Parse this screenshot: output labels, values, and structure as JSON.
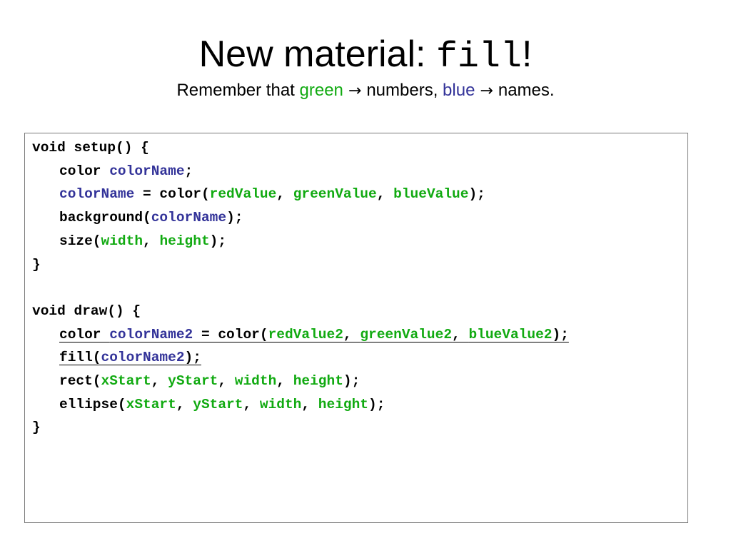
{
  "slide": {
    "title_main": "New material: ",
    "title_code": "fill",
    "title_end": "!",
    "subtitle": {
      "part1": "Remember that ",
      "green_word": "green",
      "arrow1": " → ",
      "part2": "numbers, ",
      "blue_word": "blue",
      "arrow2": " → ",
      "part3": "names."
    }
  },
  "colors": {
    "green_numbers": "#11aa11",
    "blue_names": "#333399"
  },
  "code": {
    "lines": [
      {
        "indent": false,
        "underline": false,
        "tokens": [
          {
            "text": "void setup() {",
            "type": "plain"
          }
        ]
      },
      {
        "indent": true,
        "underline": false,
        "tokens": [
          {
            "text": "color ",
            "type": "plain"
          },
          {
            "text": "colorName",
            "type": "name"
          },
          {
            "text": ";",
            "type": "plain"
          }
        ]
      },
      {
        "indent": true,
        "underline": false,
        "tokens": [
          {
            "text": "colorName",
            "type": "name"
          },
          {
            "text": " = color(",
            "type": "plain"
          },
          {
            "text": "redValue",
            "type": "num"
          },
          {
            "text": ", ",
            "type": "plain"
          },
          {
            "text": "greenValue",
            "type": "num"
          },
          {
            "text": ", ",
            "type": "plain"
          },
          {
            "text": "blueValue",
            "type": "num"
          },
          {
            "text": ");",
            "type": "plain"
          }
        ]
      },
      {
        "indent": true,
        "underline": false,
        "tokens": [
          {
            "text": "background(",
            "type": "plain"
          },
          {
            "text": "colorName",
            "type": "name"
          },
          {
            "text": ");",
            "type": "plain"
          }
        ]
      },
      {
        "indent": true,
        "underline": false,
        "tokens": [
          {
            "text": "size(",
            "type": "plain"
          },
          {
            "text": "width",
            "type": "num"
          },
          {
            "text": ", ",
            "type": "plain"
          },
          {
            "text": "height",
            "type": "num"
          },
          {
            "text": ");",
            "type": "plain"
          }
        ]
      },
      {
        "indent": false,
        "underline": false,
        "tokens": [
          {
            "text": "}",
            "type": "plain"
          }
        ]
      },
      {
        "indent": false,
        "underline": false,
        "tokens": [
          {
            "text": "",
            "type": "plain"
          }
        ]
      },
      {
        "indent": false,
        "underline": false,
        "tokens": [
          {
            "text": "void draw() {",
            "type": "plain"
          }
        ]
      },
      {
        "indent": true,
        "underline": true,
        "tokens": [
          {
            "text": "color ",
            "type": "plain"
          },
          {
            "text": "colorName2 ",
            "type": "name"
          },
          {
            "text": "= color(",
            "type": "plain"
          },
          {
            "text": "redValue2",
            "type": "num"
          },
          {
            "text": ", ",
            "type": "plain"
          },
          {
            "text": "greenValue2",
            "type": "num"
          },
          {
            "text": ", ",
            "type": "plain"
          },
          {
            "text": "blueValue2",
            "type": "num"
          },
          {
            "text": ");",
            "type": "plain"
          }
        ]
      },
      {
        "indent": true,
        "underline": true,
        "tokens": [
          {
            "text": "fill(",
            "type": "plain"
          },
          {
            "text": "colorName2",
            "type": "name"
          },
          {
            "text": ");",
            "type": "plain"
          }
        ]
      },
      {
        "indent": true,
        "underline": false,
        "tokens": [
          {
            "text": "rect(",
            "type": "plain"
          },
          {
            "text": "xStart",
            "type": "num"
          },
          {
            "text": ", ",
            "type": "plain"
          },
          {
            "text": "yStart",
            "type": "num"
          },
          {
            "text": ", ",
            "type": "plain"
          },
          {
            "text": "width",
            "type": "num"
          },
          {
            "text": ", ",
            "type": "plain"
          },
          {
            "text": "height",
            "type": "num"
          },
          {
            "text": ");",
            "type": "plain"
          }
        ]
      },
      {
        "indent": true,
        "underline": false,
        "tokens": [
          {
            "text": "ellipse(",
            "type": "plain"
          },
          {
            "text": "xStart",
            "type": "num"
          },
          {
            "text": ", ",
            "type": "plain"
          },
          {
            "text": "yStart",
            "type": "num"
          },
          {
            "text": ", ",
            "type": "plain"
          },
          {
            "text": "width",
            "type": "num"
          },
          {
            "text": ", ",
            "type": "plain"
          },
          {
            "text": "height",
            "type": "num"
          },
          {
            "text": ");",
            "type": "plain"
          }
        ]
      },
      {
        "indent": false,
        "underline": false,
        "tokens": [
          {
            "text": "}",
            "type": "plain"
          }
        ]
      }
    ]
  }
}
